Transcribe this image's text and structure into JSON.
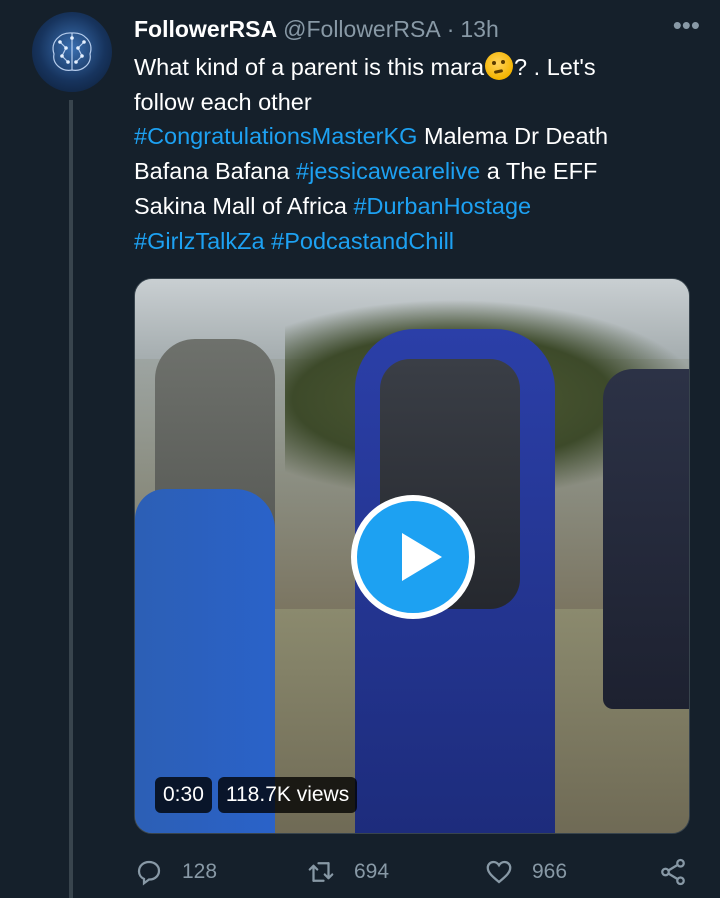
{
  "tweet": {
    "display_name": "FollowerRSA",
    "handle": "@FollowerRSA",
    "separator": "·",
    "time": "13h",
    "more_label": "•••",
    "text": {
      "line1_a": "What kind of a parent is this mara",
      "line1_b": "? . Let's",
      "line2": "follow each other",
      "line3_tag": "#CongratulationsMasterKG",
      "line3_rest": " Malema Dr Death",
      "line4_a": "Bafana Bafana ",
      "line4_tag": "#jessicawearelive",
      "line4_rest": " a The EFF",
      "line5_a": "Sakina Mall of Africa ",
      "line5_tag": "#DurbanHostage",
      "line6_tag1": "#GirlzTalkZa",
      "line6_sep": " ",
      "line6_tag2": "#PodcastandChill"
    },
    "emoji": "thinking-face",
    "video": {
      "duration": "0:30",
      "views": "118.7K views"
    },
    "actions": {
      "replies": "128",
      "retweets": "694",
      "likes": "966"
    }
  },
  "colors": {
    "background": "#15202b",
    "link": "#1da1f2",
    "secondary_text": "#8899a6",
    "divider": "#38444d",
    "play_button": "#1da1f2"
  },
  "icons": [
    "brain-avatar-icon",
    "more-icon",
    "play-icon",
    "reply-icon",
    "retweet-icon",
    "like-icon",
    "share-icon"
  ]
}
